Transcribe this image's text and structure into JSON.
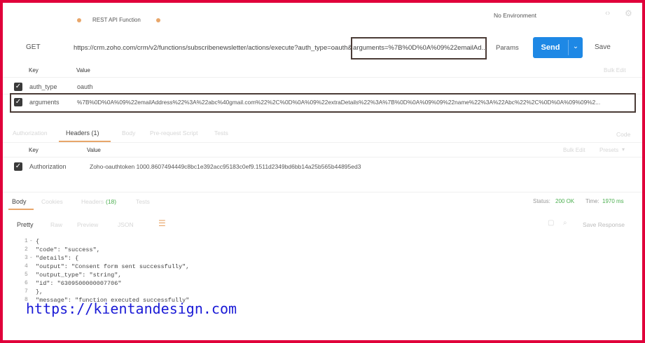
{
  "tabs": {
    "first_tab_label": "",
    "active_tab_label": "REST API Function",
    "second_tab_label": "",
    "dot_color": "#e8a66a"
  },
  "environment": {
    "label": "No Environment"
  },
  "request": {
    "method": "GET",
    "url_prefix": "https://crm.zoho.com/crm/v2/functions/subscribenewsletter/actions/execute?auth_type=oauth&",
    "url_highlight": "arguments=%7B%0D%0A%09%22emailAd...",
    "params_label": "Params",
    "send_label": "Send",
    "save_label": "Save"
  },
  "params_table": {
    "key_header": "Key",
    "value_header": "Value",
    "bulk_edit_label": "Bulk Edit",
    "rows": [
      {
        "key": "auth_type",
        "value": "oauth"
      },
      {
        "key": "arguments",
        "value": "%7B%0D%0A%09%22emailAddress%22%3A%22abc%40gmail.com%22%2C%0D%0A%09%22extraDetails%22%3A%7B%0D%0A%09%09%22name%22%3A%22Abc%22%2C%0D%0A%09%09%2..."
      }
    ]
  },
  "request_tabs": {
    "authorization_label": "Authorization",
    "headers_label": "Headers (1)",
    "body_label": "Body",
    "prerequest_label": "Pre-request Script",
    "tests_label": "Tests",
    "code_label": "Code"
  },
  "headers_table": {
    "key_header": "Key",
    "value_header": "Value",
    "bulk_edit_label": "Bulk Edit",
    "presets_label": "Presets",
    "rows": [
      {
        "key": "Authorization",
        "value": "Zoho-oauthtoken 1000.8607494449c8bc1e392acc95183c0ef9.1511d2349bd6bb14a25b565b44895ed3"
      }
    ]
  },
  "response_tabs": {
    "body_label": "Body",
    "cookies_label": "Cookies",
    "headers_label": "Headers",
    "headers_count": "(18)",
    "tests_label": "Tests"
  },
  "response_meta": {
    "status_label": "Status:",
    "status_value": "200 OK",
    "time_label": "Time:",
    "time_value": "1970 ms"
  },
  "view_options": {
    "pretty_label": "Pretty",
    "raw_label": "Raw",
    "preview_label": "Preview",
    "format_label": "JSON",
    "save_response_label": "Save Response"
  },
  "response_body": {
    "lines": [
      {
        "num": "1",
        "fold": "-",
        "text": "{"
      },
      {
        "num": "2",
        "fold": "",
        "text": "    \"code\": \"success\","
      },
      {
        "num": "3",
        "fold": "-",
        "text": "    \"details\": {"
      },
      {
        "num": "4",
        "fold": "",
        "text": "        \"output\": \"Consent form sent successfully\","
      },
      {
        "num": "5",
        "fold": "",
        "text": "        \"output_type\": \"string\","
      },
      {
        "num": "6",
        "fold": "",
        "text": "        \"id\": \"6309500000007706\""
      },
      {
        "num": "7",
        "fold": "",
        "text": "    },"
      },
      {
        "num": "8",
        "fold": "",
        "text": "    \"message\": \"function executed successfully\""
      }
    ]
  },
  "watermark": {
    "text": "https://kientandesign.com"
  }
}
